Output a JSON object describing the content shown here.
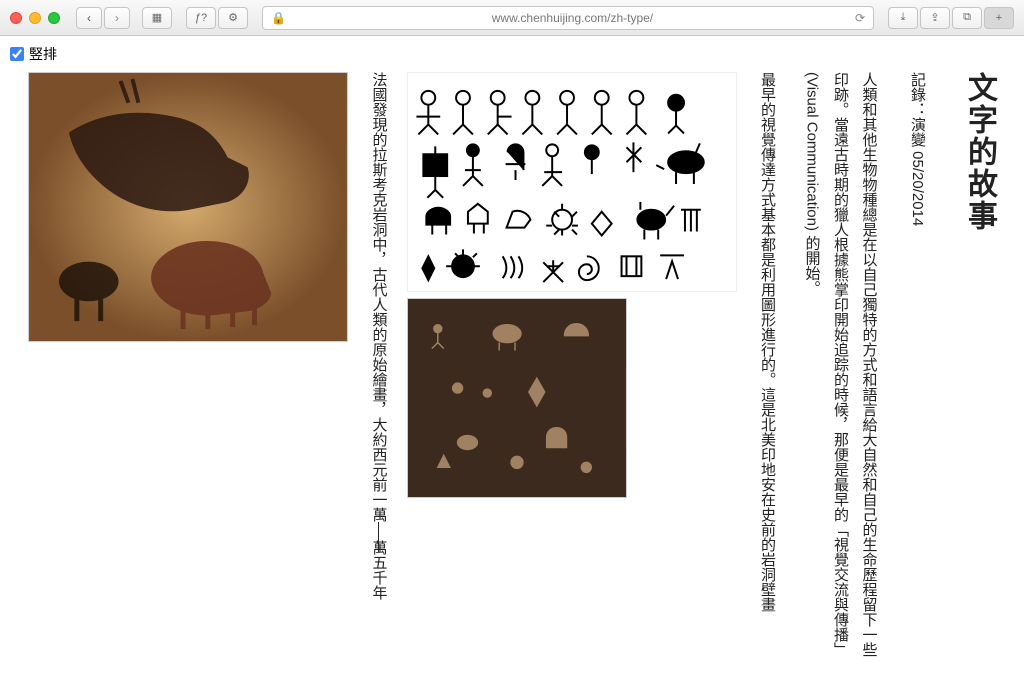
{
  "browser": {
    "url_display": "www.chenhuijing.com/zh-type/",
    "reader_glyph": "ƒ?",
    "plugin_glyph": "⚙",
    "nav_back": "‹",
    "nav_forward": "›",
    "sidebar_glyph": "▦",
    "lock_glyph": "🔒",
    "reload_glyph": "⟳",
    "download_glyph": "⤓",
    "share_glyph": "⇪",
    "tabs_glyph": "⧉",
    "newtab_glyph": "+"
  },
  "toggle": {
    "label": "竪排",
    "checked": true
  },
  "article": {
    "title": "文字的故事",
    "meta": "記錄：演變 05/20/2014",
    "p1": "人類和其他生物物種總是在以自己獨特的方式和語言給大自然和自己的生命歷程留下一些印跡。當遠古時期的獵人根據熊掌印開始追踪的時候，那便是最早的「視覺交流與傳播」(Visual Communication) 的開始。",
    "p2": "最早的視覺傳達方式基本都是利用圖形進行的。這是北美印地安在史前的岩洞壁畫",
    "p3_pre": "法國發現的拉斯考克岩洞中，古代人類的原始繪畫，大約西元前一萬",
    "p3_post": "萬五千年"
  }
}
